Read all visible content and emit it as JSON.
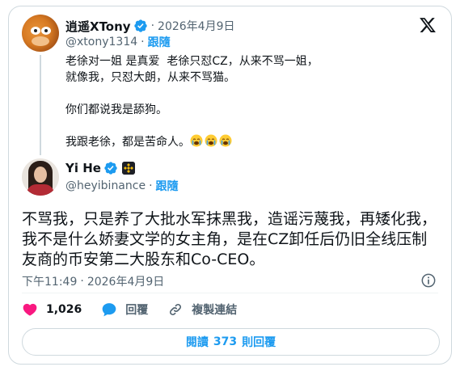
{
  "quoted": {
    "name": "逍遥XTony",
    "handle": "@xtony1314",
    "date": "2026年4月9日",
    "follow_label": "跟隨",
    "lines": [
      "老徐对一姐 是真爱  老徐只怼CZ，从来不骂一姐，",
      "就像我，只怼大朗，从来不骂猫。",
      "",
      "你们都说我是舔狗。",
      "",
      "我跟老徐，都是苦命人。"
    ]
  },
  "main": {
    "name": "Yi He",
    "handle": "@heyibinance",
    "follow_label": "跟隨",
    "text": "不骂我，只是养了大批水军抹黑我，造谣污蔑我，再矮化我，我不是什么娇妻文学的女主角，是在CZ卸任后仍旧全线压制友商的币安第二大股东和Co-CEO。",
    "time": "下午11:49",
    "date": "2026年4月9日"
  },
  "actions": {
    "likes": "1,026",
    "reply_label": "回覆",
    "copy_link_label": "複製連結"
  },
  "read_button": {
    "prefix": "閱讀",
    "count": "373",
    "suffix": "則回覆"
  },
  "colors": {
    "accent": "#1d9bf0",
    "like": "#f91880",
    "text": "#0f1419",
    "muted": "#536471",
    "border": "#cfd9de"
  },
  "icons": [
    "verified-badge-icon",
    "x-logo-icon",
    "crying-face-emoji",
    "binance-affiliate-icon",
    "info-icon",
    "heart-icon",
    "reply-bubble-icon",
    "link-icon"
  ]
}
